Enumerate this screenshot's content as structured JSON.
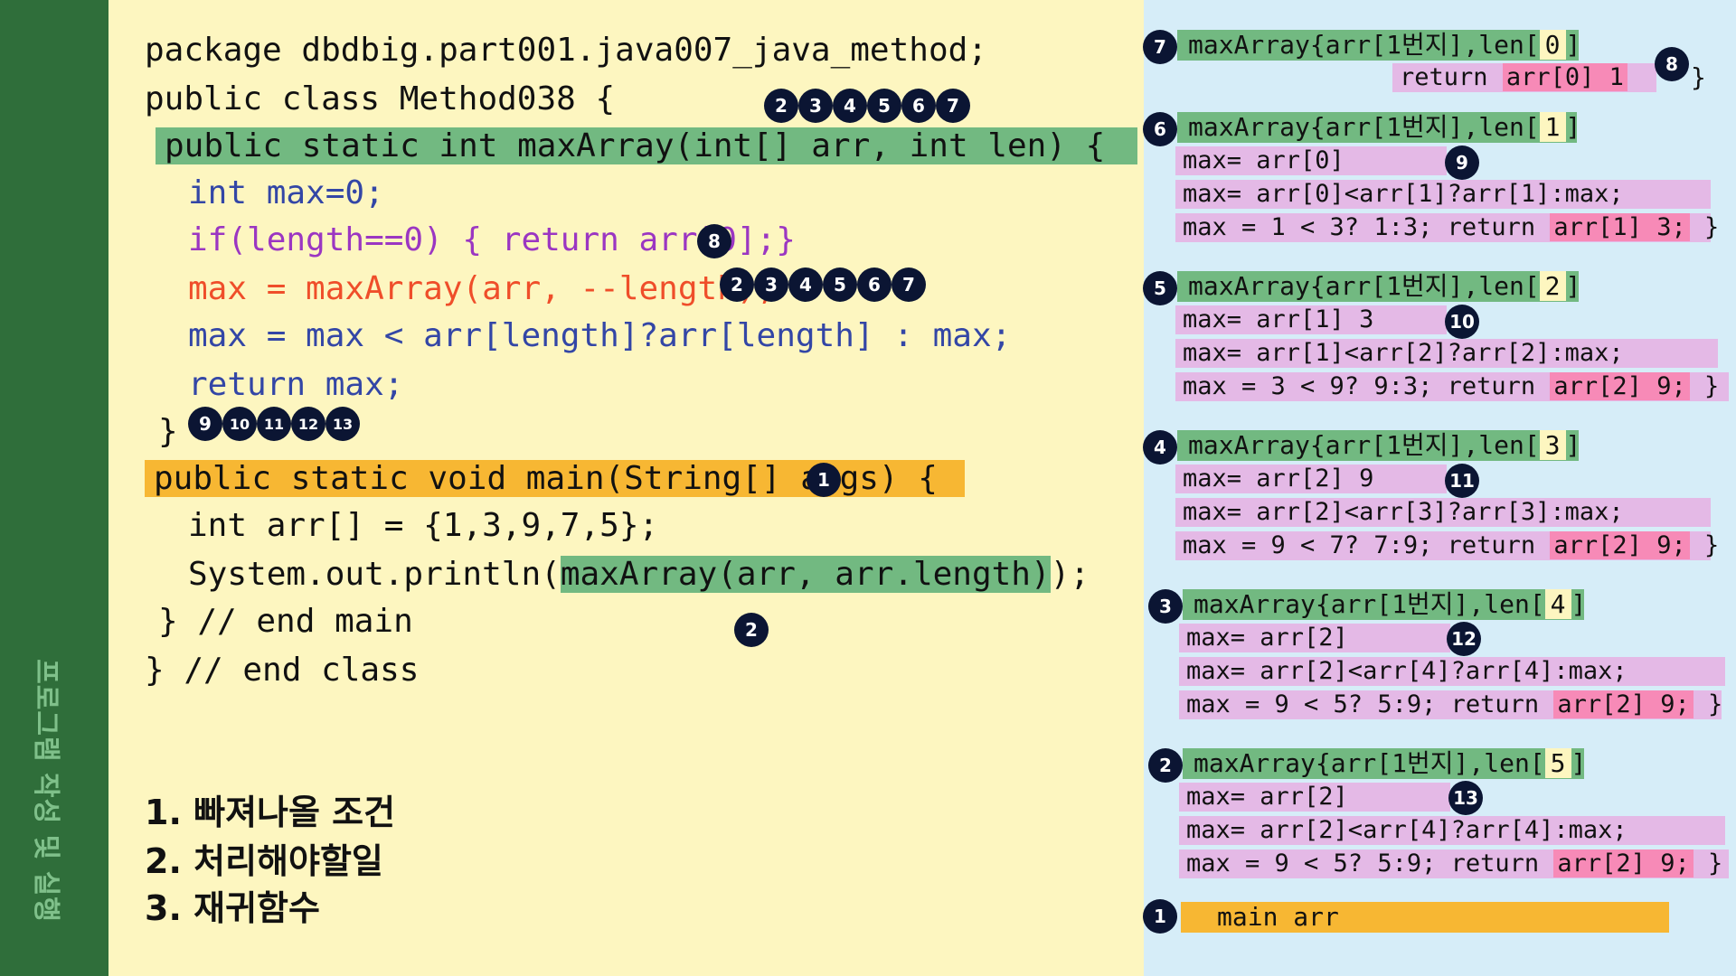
{
  "sidebar": {
    "label": "프로그램 작성 및 실행"
  },
  "code": {
    "line1": "package dbdbig.part001.java007_java_method;",
    "line2": "public class Method038 {",
    "line2_badges": [
      "2",
      "3",
      "4",
      "5",
      "6",
      "7"
    ],
    "line3": "public static  int maxArray(int[] arr, int len) {",
    "line4": "int max=0;",
    "line5": "if(length==0) { return arr[0];}",
    "line5_badge": "8",
    "line6": "max = maxArray(arr, --length);",
    "line6_badges": [
      "2",
      "3",
      "4",
      "5",
      "6",
      "7"
    ],
    "line7": "max = max < arr[length]?arr[length] : max;",
    "line8": "return max;",
    "line9": "}",
    "line9_badges": [
      "9",
      "10",
      "11",
      "12",
      "13"
    ],
    "line10": "public static void main(String[] args) {",
    "line10_badge": "1",
    "line11": "int arr[] = {1,3,9,7,5};",
    "line12_pre": "System.out.println(",
    "line12_hl": "maxArray(arr, arr.length)",
    "line12_post": ");",
    "line13": "} // end main",
    "line13_badge": "2",
    "line14": "} // end class"
  },
  "notes": [
    "1. 빠져나올 조건",
    "2. 처리해야할일",
    "3. 재귀함수"
  ],
  "stack": {
    "frames": [
      {
        "num": "7",
        "head": "maxArray{arr[1번지],len[",
        "len": "0",
        "close": "]",
        "return_label": "return",
        "return_val": "arr[0]  1",
        "badge": "8",
        "brace": "}"
      },
      {
        "num": "6",
        "head": "maxArray{arr[1번지],len[",
        "len": "1",
        "close": "]",
        "row1": "max= arr[0]",
        "badge": "9",
        "row2": "max= arr[0]<arr[1]?arr[1]:max;",
        "row3": "max = 1 < 3?  1:3;    return",
        "ret": "arr[1]  3;",
        "brace": "}"
      },
      {
        "num": "5",
        "head": "maxArray{arr[1번지],len[",
        "len": "2",
        "close": "]",
        "row1": "max= arr[1]   3",
        "badge": "10",
        "row2": "max= arr[1]<arr[2]?arr[2]:max;",
        "row3": "max = 3 < 9?  9:3;    return",
        "ret": "arr[2]  9;",
        "brace": "}"
      },
      {
        "num": "4",
        "head": "maxArray{arr[1번지],len[",
        "len": "3",
        "close": "]",
        "row1": "max= arr[2]  9",
        "badge": "11",
        "row2": "max= arr[2]<arr[3]?arr[3]:max;",
        "row3": "max = 9 < 7? 7:9;    return",
        "ret": "arr[2]  9;",
        "brace": "}"
      },
      {
        "num": "3",
        "head": "maxArray{arr[1번지],len[",
        "len": "4",
        "close": "]",
        "row1": "max= arr[2]",
        "badge": "12",
        "row2": "max= arr[2]<arr[4]?arr[4]:max;",
        "row3": "max = 9 < 5?  5:9;    return",
        "ret": "arr[2]  9;",
        "brace": "}"
      },
      {
        "num": "2",
        "head": "maxArray{arr[1번지],len[",
        "len": "5",
        "close": "]",
        "row1": "max= arr[2]",
        "badge": "13",
        "row2": "max= arr[2]<arr[4]?arr[4]:max;",
        "row3": "max = 9 < 5?  5:9;    return",
        "ret": "arr[2]  9;",
        "brace": "}"
      }
    ],
    "main_frame": {
      "num": "1",
      "label": "main      arr"
    }
  }
}
